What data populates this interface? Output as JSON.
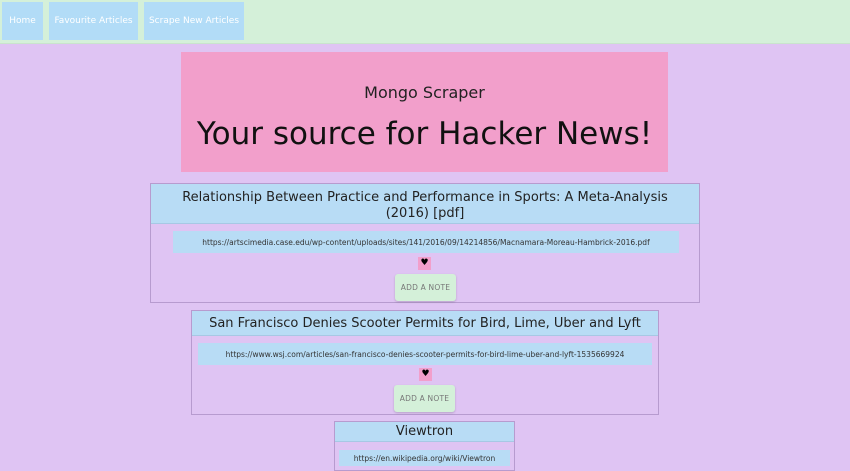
{
  "nav": {
    "home": "Home",
    "favourites": "Favourite Articles",
    "scrape": "Scrape New Articles"
  },
  "hero": {
    "subtitle": "Mongo Scraper",
    "title": "Your source for Hacker News!"
  },
  "articles": [
    {
      "title": "Relationship Between Practice and Performance in Sports: A Meta-Analysis (2016) [pdf]",
      "url": "https://artscimedia.case.edu/wp-content/uploads/sites/141/2016/09/14214856/Macnamara-Moreau-Hambrick-2016.pdf",
      "favourite_icon": "heart-icon",
      "note_label": "ADD A NOTE"
    },
    {
      "title": "San Francisco Denies Scooter Permits for Bird, Lime, Uber and Lyft",
      "url": "https://www.wsj.com/articles/san-francisco-denies-scooter-permits-for-bird-lime-uber-and-lyft-1535669924",
      "favourite_icon": "heart-icon",
      "note_label": "ADD A NOTE"
    },
    {
      "title": "Viewtron",
      "url": "https://en.wikipedia.org/wiki/Viewtron"
    }
  ],
  "colors": {
    "page_background": "#dfc4f3",
    "navbar": "#d4f0d9",
    "nav_button": "#b2dcf7",
    "hero": "#f29fcb",
    "card_header": "#b8dcf5"
  }
}
